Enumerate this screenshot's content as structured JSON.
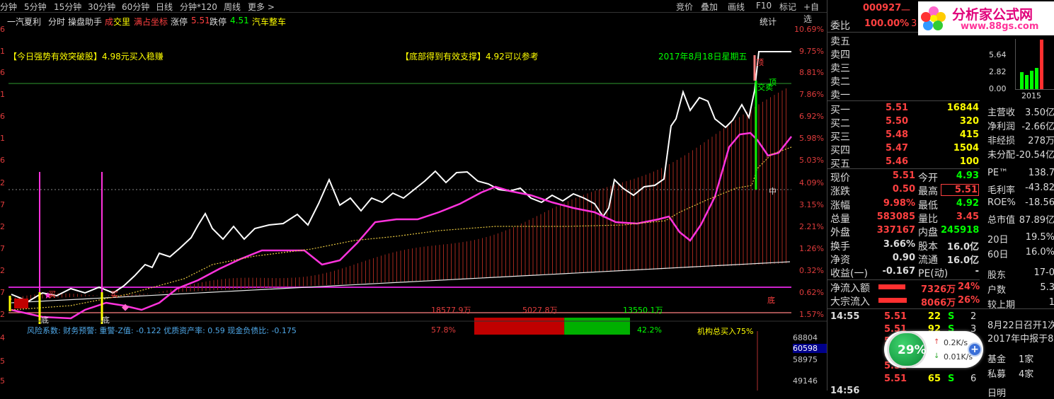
{
  "toolbar": {
    "periods": [
      "分钟",
      "5分钟",
      "15分钟",
      "30分钟",
      "60分钟",
      "日线",
      "分钟*120",
      "周线",
      "更多 >"
    ],
    "right": [
      "竞价",
      "叠加",
      "画线",
      "F10",
      "标记",
      "+自选"
    ]
  },
  "chart_header": {
    "stock_name": "一汽夏利",
    "items": [
      "分时",
      "操盘助手"
    ],
    "chengjiao_a": "成",
    "chengjiao_b": "交里",
    "full_coord": "满占坐标",
    "zhangting_label": "涨停",
    "zhangting_val": "5.51",
    "dieting_label": "跌停",
    "dieting_val": "4.51",
    "sector": "汽车整车",
    "stats": "统计"
  },
  "annotations": {
    "breakout": "【今日强势有效突破股】4.98元买入稳赚",
    "support": "【底部得到有效支撑】4.92可以参考",
    "date": "2017年8月18日星期五",
    "ding1": "顶",
    "ding2": "顶",
    "jiaomai": "交卖",
    "di1": "底",
    "di2": "底",
    "di_right": "底",
    "zhong": "中",
    "mai1": "买",
    "mai2": "买"
  },
  "right_axis": [
    "10.69%",
    "9.75%",
    "8.81%",
    "7.86%",
    "6.92%",
    "5.98%",
    "5.03%",
    "4.09%",
    "3.15%",
    "2.21%",
    "1.26%",
    "0.32%",
    "0.62%",
    "1.57%"
  ],
  "left_axis": [
    "6",
    "1",
    "6",
    "1",
    "6",
    "1",
    "6",
    "2",
    "7",
    "2",
    "7",
    "2",
    "7",
    "2"
  ],
  "volume_axis": [
    "68804",
    "60598",
    "58975",
    "49146"
  ],
  "left_vol_axis": [
    "4",
    "5",
    "5"
  ],
  "flow_bar": {
    "left_val": "18577.9万",
    "mid_val": "5027.8万",
    "right_val": "13550.1万",
    "red_pct": "57.8%",
    "green_pct": "42.2%",
    "inst": "机构总买入75%",
    "red_ratio": 0.578
  },
  "risk_text": "风险系数: 财务预警: 重警-Z值: -0.122 优质资产率: 0.59 现金负债比: -0.175",
  "quote": {
    "code": "000927",
    "code_suffix": "一",
    "weibi_label": "委比",
    "weibi_val": "100.00%",
    "weibi_extra": "3",
    "sells": [
      {
        "label": "卖五"
      },
      {
        "label": "卖四"
      },
      {
        "label": "卖三"
      },
      {
        "label": "卖二"
      },
      {
        "label": "卖一"
      }
    ],
    "buys": [
      {
        "label": "买一",
        "price": "5.51",
        "vol": "16844"
      },
      {
        "label": "买二",
        "price": "5.50",
        "vol": "320"
      },
      {
        "label": "买三",
        "price": "5.48",
        "vol": "415"
      },
      {
        "label": "买四",
        "price": "5.47",
        "vol": "1504"
      },
      {
        "label": "买五",
        "price": "5.46",
        "vol": "100"
      }
    ],
    "rows": [
      {
        "l1": "现价",
        "v1": "5.51",
        "l2": "今开",
        "v2": "4.93"
      },
      {
        "l1": "涨跌",
        "v1": "0.50",
        "l2": "最高",
        "v2": "5.51"
      },
      {
        "l1": "涨幅",
        "v1": "9.98%",
        "l2": "最低",
        "v2": "4.92"
      },
      {
        "l1": "总量",
        "v1": "583085",
        "l2": "量比",
        "v2": "3.45"
      },
      {
        "l1": "外盘",
        "v1": "337167",
        "l2": "内盘",
        "v2": "245918"
      },
      {
        "l1": "换手",
        "v1": "3.66%",
        "l2": "股本",
        "v2": "16.0亿"
      },
      {
        "l1": "净资",
        "v1": "0.90",
        "l2": "流通",
        "v2": "16.0亿"
      },
      {
        "l1": "收益(一)",
        "v1": "-0.167",
        "l2": "PE(动)",
        "v2": "-"
      }
    ],
    "netflow_label": "净流入额",
    "netflow_val": "7326万",
    "netflow_pct": "24%",
    "bigflow_label": "大宗流入",
    "bigflow_val": "8066万",
    "bigflow_pct": "26%",
    "time1": "14:55",
    "time2": "14:56",
    "ticks": [
      {
        "p": "5.51",
        "v": "22",
        "s": "S",
        "n": "2"
      },
      {
        "p": "5.51",
        "v": "92",
        "s": "S",
        "n": "3"
      },
      {
        "p": "5.51",
        "v": "",
        "s": "",
        "n": ""
      },
      {
        "p": "5.51",
        "v": "",
        "s": "",
        "n": ""
      },
      {
        "p": "5.51",
        "v": "",
        "s": "",
        "n": ""
      },
      {
        "p": "5.51",
        "v": "65",
        "s": "S",
        "n": "6"
      }
    ]
  },
  "logo": {
    "title": "分析家公式网",
    "url": "www.88gs.com"
  },
  "fin": {
    "axis": [
      "5.64",
      "2.82",
      "0.00"
    ],
    "year": "2015",
    "rows": [
      {
        "l": "主营收",
        "v": "3.50亿"
      },
      {
        "l": "净利润",
        "v": "-2.66亿"
      },
      {
        "l": "非经损",
        "v": "278万"
      },
      {
        "l": "未分配",
        "v": "-20.54亿"
      },
      {
        "l": "PE™",
        "v": "138.7"
      },
      {
        "l": "毛利率",
        "v": "-43.82"
      },
      {
        "l": "ROE%",
        "v": "-18.56"
      },
      {
        "l": "总市值",
        "v": "87.89亿"
      },
      {
        "l": "20日",
        "v": "19.5%"
      },
      {
        "l": "60日",
        "v": "16.0%"
      },
      {
        "l": "股东",
        "v": "17-0"
      },
      {
        "l": "户数",
        "v": "5.3"
      },
      {
        "l": "较上期",
        "v": "1"
      }
    ],
    "notice1": "8月22日召开1次",
    "notice2": "2017年中报于8",
    "fund_rows": [
      {
        "l": "基金",
        "v": "1家"
      },
      {
        "l": "私募",
        "v": "4家"
      }
    ],
    "last": "日明"
  },
  "speed": {
    "pct": "29%",
    "up": "0.2K/s",
    "down": "0.01K/s",
    "plus": "+"
  }
}
